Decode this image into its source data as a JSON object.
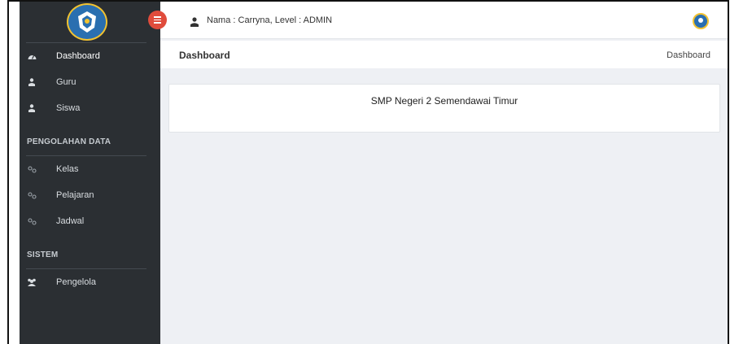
{
  "header": {
    "user_info": "Nama : Carryna, Level : ADMIN"
  },
  "sidebar": {
    "items": [
      {
        "label": "Dashboard",
        "icon": "dashboard-icon"
      },
      {
        "label": "Guru",
        "icon": "user-icon"
      },
      {
        "label": "Siswa",
        "icon": "user-icon"
      }
    ],
    "sections": [
      {
        "title": "PENGOLAHAN DATA",
        "items": [
          {
            "label": "Kelas",
            "icon": "link-icon"
          },
          {
            "label": "Pelajaran",
            "icon": "link-icon"
          },
          {
            "label": "Jadwal",
            "icon": "link-icon"
          }
        ]
      },
      {
        "title": "SISTEM",
        "items": [
          {
            "label": "Pengelola",
            "icon": "users-icon"
          }
        ]
      }
    ]
  },
  "page": {
    "title": "Dashboard",
    "breadcrumb": "Dashboard",
    "school_name": "SMP Negeri 2 Semendawai Timur"
  },
  "colors": {
    "sidebar_bg": "#2b2f33",
    "toggle_button": "#e04c3c",
    "content_bg": "#eef0f4",
    "logo_blue": "#2a6fb0",
    "logo_gold": "#f2c230"
  }
}
